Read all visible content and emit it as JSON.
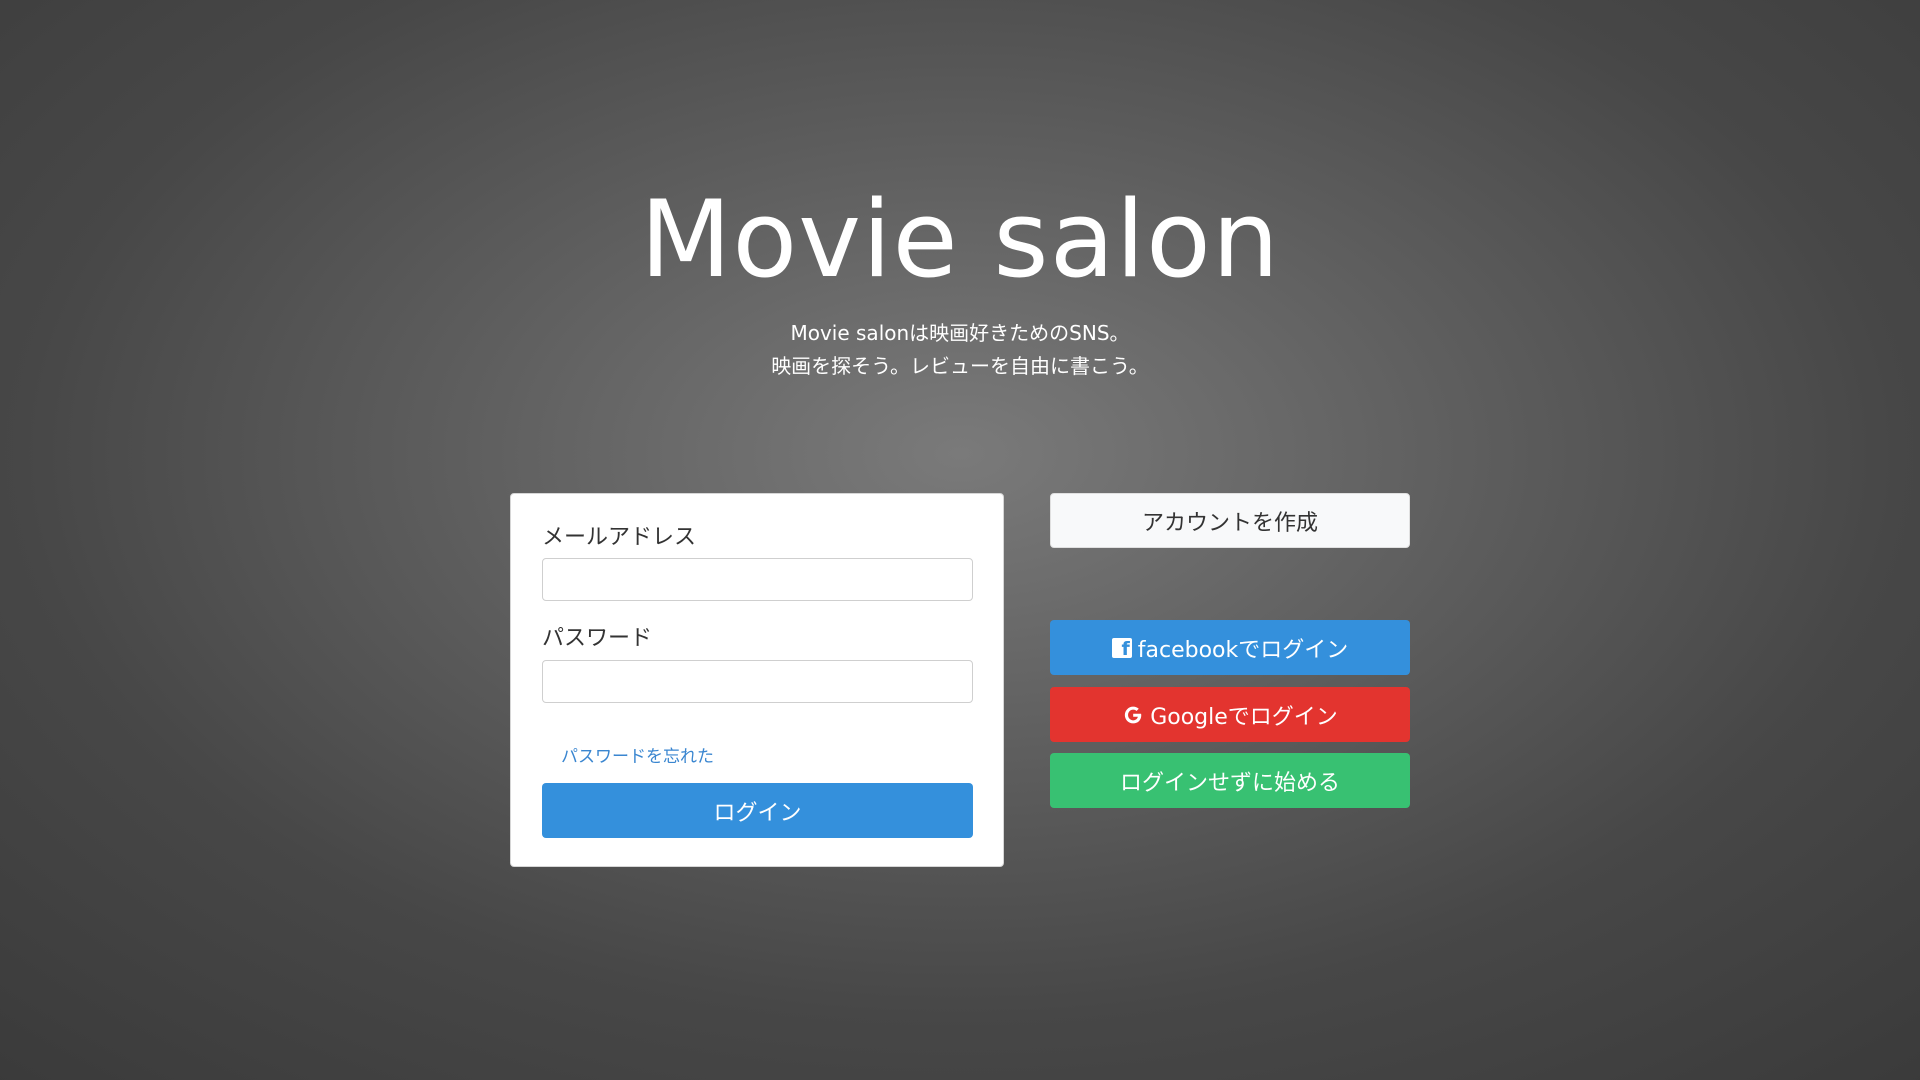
{
  "app": {
    "title": "Movie salon",
    "tagline_line1": "Movie salonは映画好きためのSNS。",
    "tagline_line2": "映画を探そう。レビューを自由に書こう。"
  },
  "login_form": {
    "email_label": "メールアドレス",
    "email_value": "",
    "password_label": "パスワード",
    "password_value": "",
    "forgot_password_link": "パスワードを忘れた",
    "login_button": "ログイン"
  },
  "side_actions": {
    "create_account": "アカウントを作成",
    "facebook_login": "facebookでログイン",
    "google_login": "Googleでログイン",
    "guest_start": "ログインせずに始める"
  },
  "colors": {
    "primary": "#3490dc",
    "danger": "#e3342f",
    "success": "#38c172",
    "light": "#f8f9fa"
  },
  "icons": {
    "facebook": "facebook-icon",
    "google": "google-icon"
  }
}
